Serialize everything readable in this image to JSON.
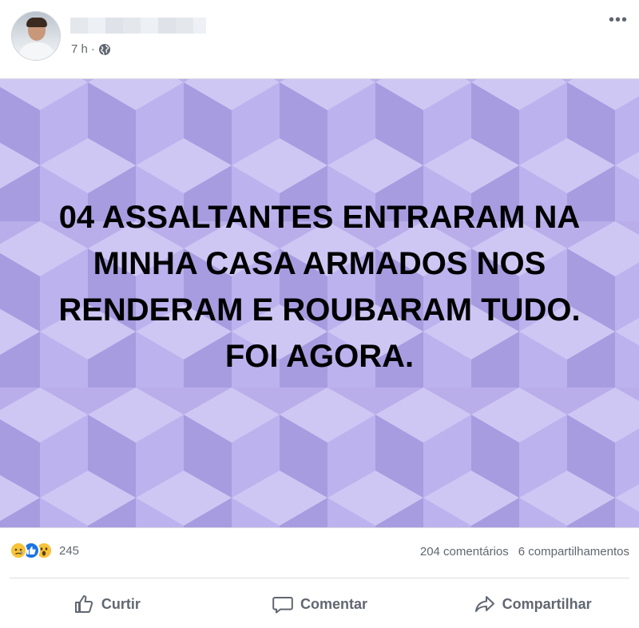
{
  "post": {
    "time": "7 h",
    "separator": "·",
    "privacy_icon": "globe-icon",
    "more_label": "•••",
    "text": "04 ASSALTANTES ENTRARAM NA MINHA CASA ARMADOS NOS RENDERAM E ROUBARAM TUDO. FOI AGORA.",
    "background_color": "#b9aeea"
  },
  "stats": {
    "reactions": [
      "sad",
      "like",
      "wow"
    ],
    "reaction_count": "245",
    "comments": "204 comentários",
    "shares": "6 compartilhamentos"
  },
  "actions": {
    "like": "Curtir",
    "comment": "Comentar",
    "share": "Compartilhar"
  }
}
